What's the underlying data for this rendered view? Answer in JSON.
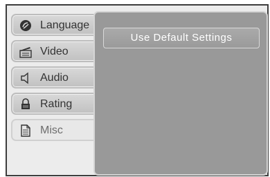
{
  "menu": {
    "tabs": [
      {
        "label": "Language",
        "icon": "language-disc-icon"
      },
      {
        "label": "Video",
        "icon": "video-clapper-icon"
      },
      {
        "label": "Audio",
        "icon": "speaker-icon"
      },
      {
        "label": "Rating",
        "icon": "lock-icon"
      },
      {
        "label": "Misc",
        "icon": "document-icon"
      }
    ],
    "active_tab": "Misc"
  },
  "panel": {
    "options": [
      {
        "label": "Use Default Settings"
      }
    ]
  }
}
